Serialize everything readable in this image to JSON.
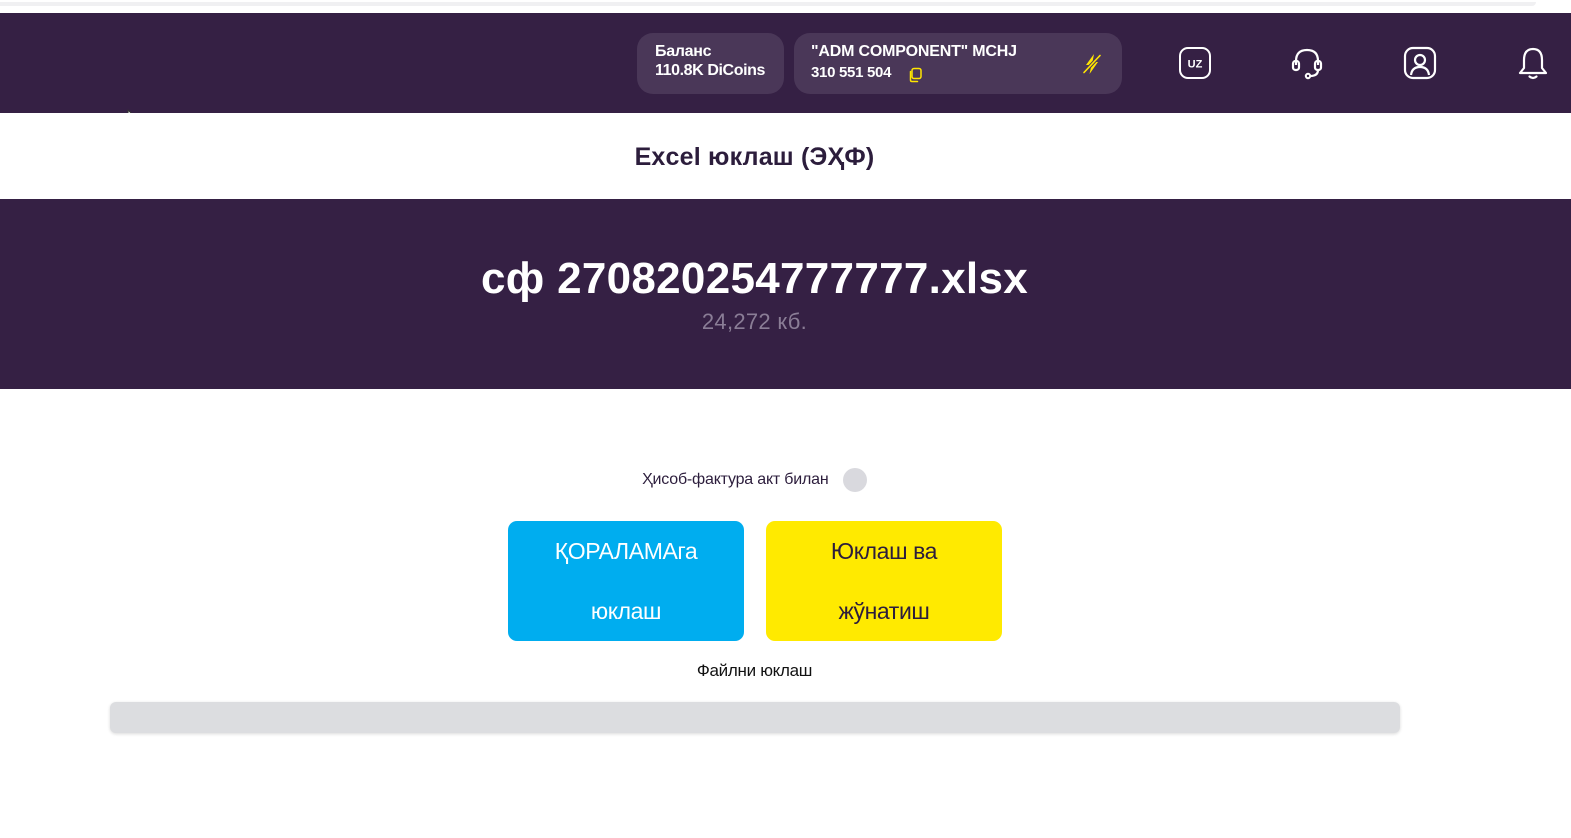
{
  "header": {
    "balance": {
      "label": "Баланс",
      "value": "110.8K DiCoins"
    },
    "company": {
      "name": "\"ADM COMPONENT\" MCHJ",
      "tin": "310 551 504"
    },
    "language": "UZ",
    "icons": [
      "copy-icon",
      "lightning-off-icon",
      "language-icon",
      "headset-icon",
      "profile-icon",
      "bell-icon"
    ],
    "colors": {
      "background": "#352044",
      "pill": "#4a3758",
      "accent": "#ffe600"
    }
  },
  "page": {
    "title": "Excel юклаш (ЭҲФ)"
  },
  "file": {
    "name": "сф 270820254777777.xlsx",
    "size": "24,272 кб."
  },
  "options": {
    "invoice_with_act_label": "Ҳисоб-фактура акт билан",
    "invoice_with_act_enabled": false
  },
  "actions": {
    "upload_to_drafts": "ҚОРАЛАМАга юклаш",
    "upload_and_send": "Юклаш ва жўнатиш",
    "colors": {
      "upload_to_drafts": "#00adef",
      "upload_and_send": "#ffea00"
    }
  },
  "upload": {
    "label": "Файлни юклаш"
  }
}
